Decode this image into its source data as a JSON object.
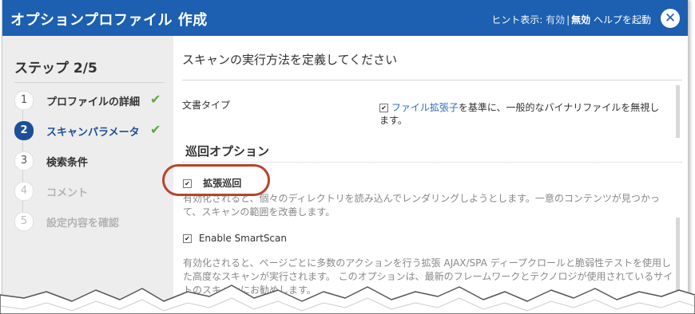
{
  "dialog": {
    "title": "オプションプロファイル 作成",
    "hint_prefix": "ヒント表示: ",
    "hint_on": "有効",
    "hint_sep": "|",
    "hint_off": "無効",
    "help": "ヘルプを起動",
    "close_glyph": "✕"
  },
  "sidebar": {
    "heading": "ステップ 2/5",
    "steps": [
      {
        "num": "1",
        "label": "プロファイルの詳細",
        "check": "✔"
      },
      {
        "num": "2",
        "label": "スキャンパラメータ",
        "check": "✔"
      },
      {
        "num": "3",
        "label": "検索条件"
      },
      {
        "num": "4",
        "label": "コメント"
      },
      {
        "num": "5",
        "label": "設定内容を確認"
      }
    ]
  },
  "main": {
    "title": "スキャンの実行方法を定義してください",
    "file_type": {
      "label": "文書タイプ",
      "checked": true,
      "link": "ファイル拡張子",
      "text": "を基準に、一般的なバイナリファイルを無視します。"
    },
    "section_title": "巡回オプション",
    "extended_crawl": {
      "label": "拡張巡回",
      "checked": true,
      "description": "有効化されると、個々のディレクトリを読み込んでレンダリングしようとします。一意のコンテンツが見つかって、スキャンの範囲を改善します。"
    },
    "smartscan": {
      "label": "Enable SmartScan",
      "checked": true,
      "description": "有効化されると、ページごとに多数のアクションを行う拡張 AJAX/SPA ディープクロールと脆弱性テストを使用した高度なスキャンが実行されます。 このオプションは、最新のフレームワークとテクノロジが使用されているサイトのスキャンにお勧めします。"
    }
  },
  "check_glyph": "✔",
  "colors": {
    "titlebar": "#1d5fb0",
    "active_step": "#1d4f98",
    "checkmark": "#5aaa3c",
    "link": "#2a6cc5",
    "annotation": "#b5452c"
  }
}
